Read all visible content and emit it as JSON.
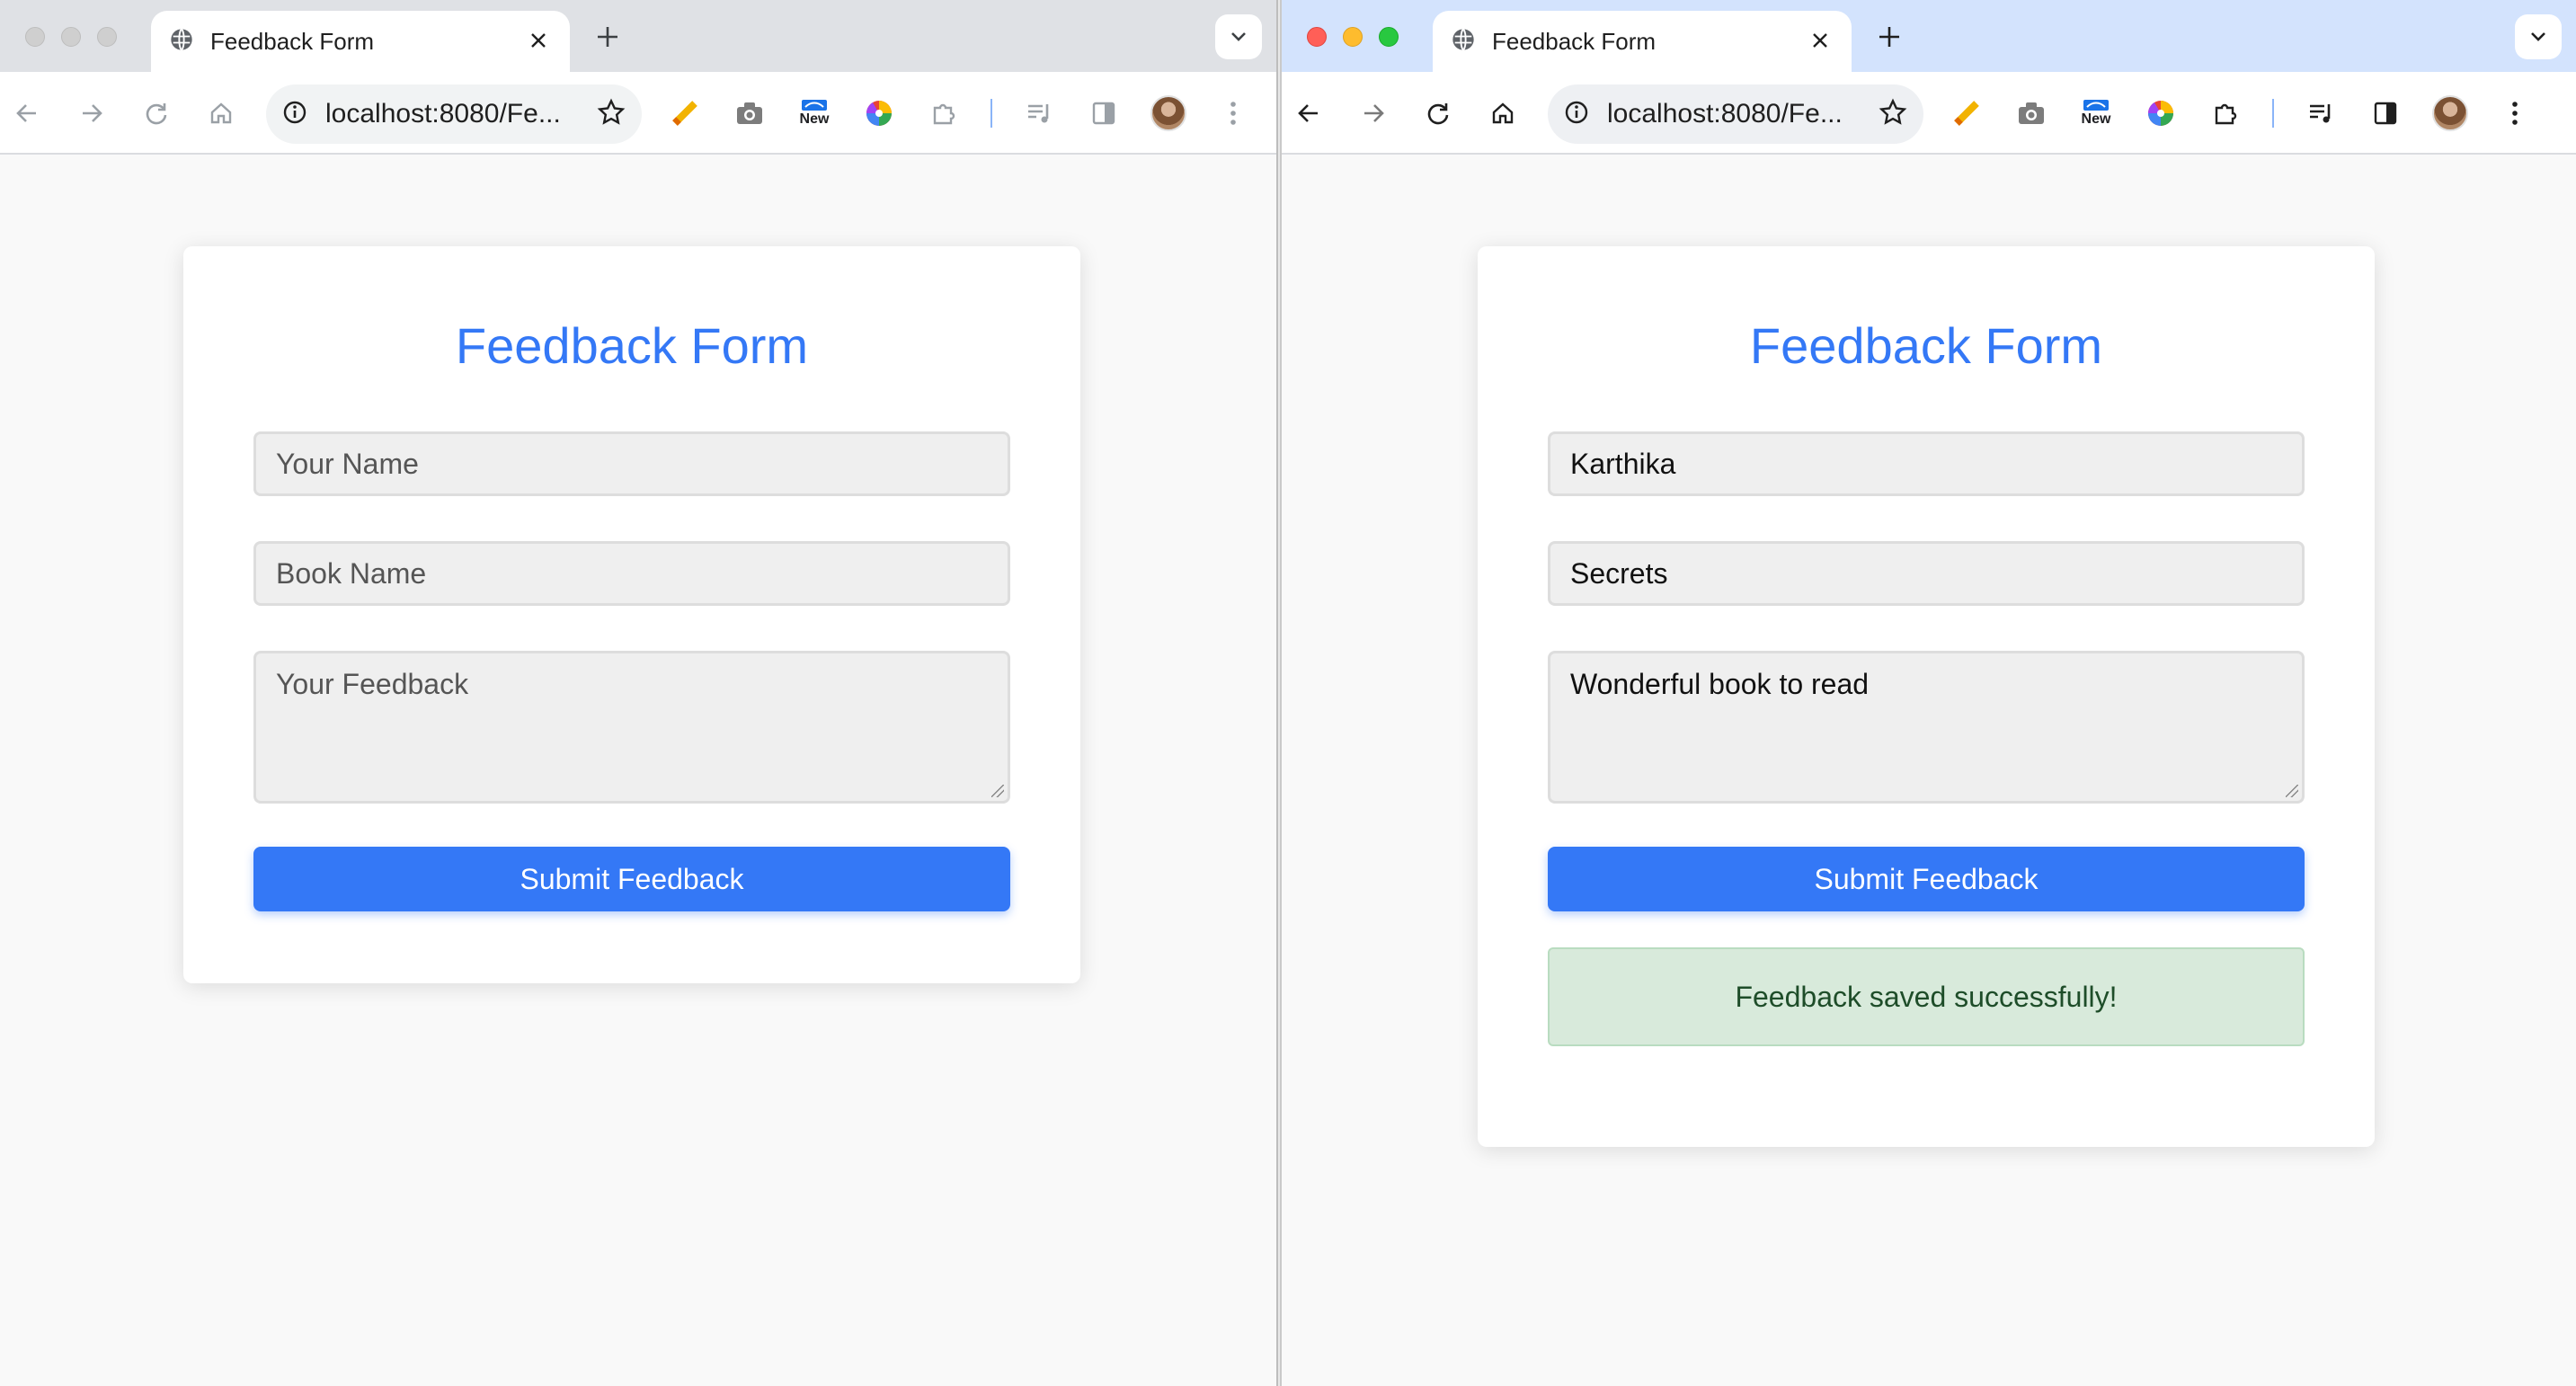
{
  "left_window": {
    "tab_title": "Feedback Form",
    "url": "localhost:8080/Fe...",
    "new_badge": "New",
    "form": {
      "title": "Feedback Form",
      "name_placeholder": "Your Name",
      "book_placeholder": "Book Name",
      "feedback_placeholder": "Your Feedback",
      "submit_label": "Submit Feedback"
    }
  },
  "right_window": {
    "tab_title": "Feedback Form",
    "url": "localhost:8080/Fe...",
    "new_badge": "New",
    "form": {
      "title": "Feedback Form",
      "name_value": "Karthika",
      "book_value": "Secrets",
      "feedback_value": "Wonderful book to read",
      "submit_label": "Submit Feedback",
      "success_message": "Feedback saved successfully!"
    }
  },
  "colors": {
    "accent": "#3478f6",
    "success_bg": "#d8eadb",
    "success_text": "#1e4d29",
    "right_tabstrip": "#d3e3fd",
    "left_tabstrip": "#dfe1e5"
  },
  "icons": [
    "globe-icon",
    "close-icon",
    "plus-icon",
    "chevron-down-icon",
    "back-icon",
    "forward-icon",
    "reload-icon",
    "home-icon",
    "info-icon",
    "star-icon",
    "pencil-extension-icon",
    "camera-icon",
    "new-extension-icon",
    "color-wheel-icon",
    "puzzle-icon",
    "media-queue-icon",
    "side-panel-icon",
    "avatar",
    "more-icon"
  ]
}
